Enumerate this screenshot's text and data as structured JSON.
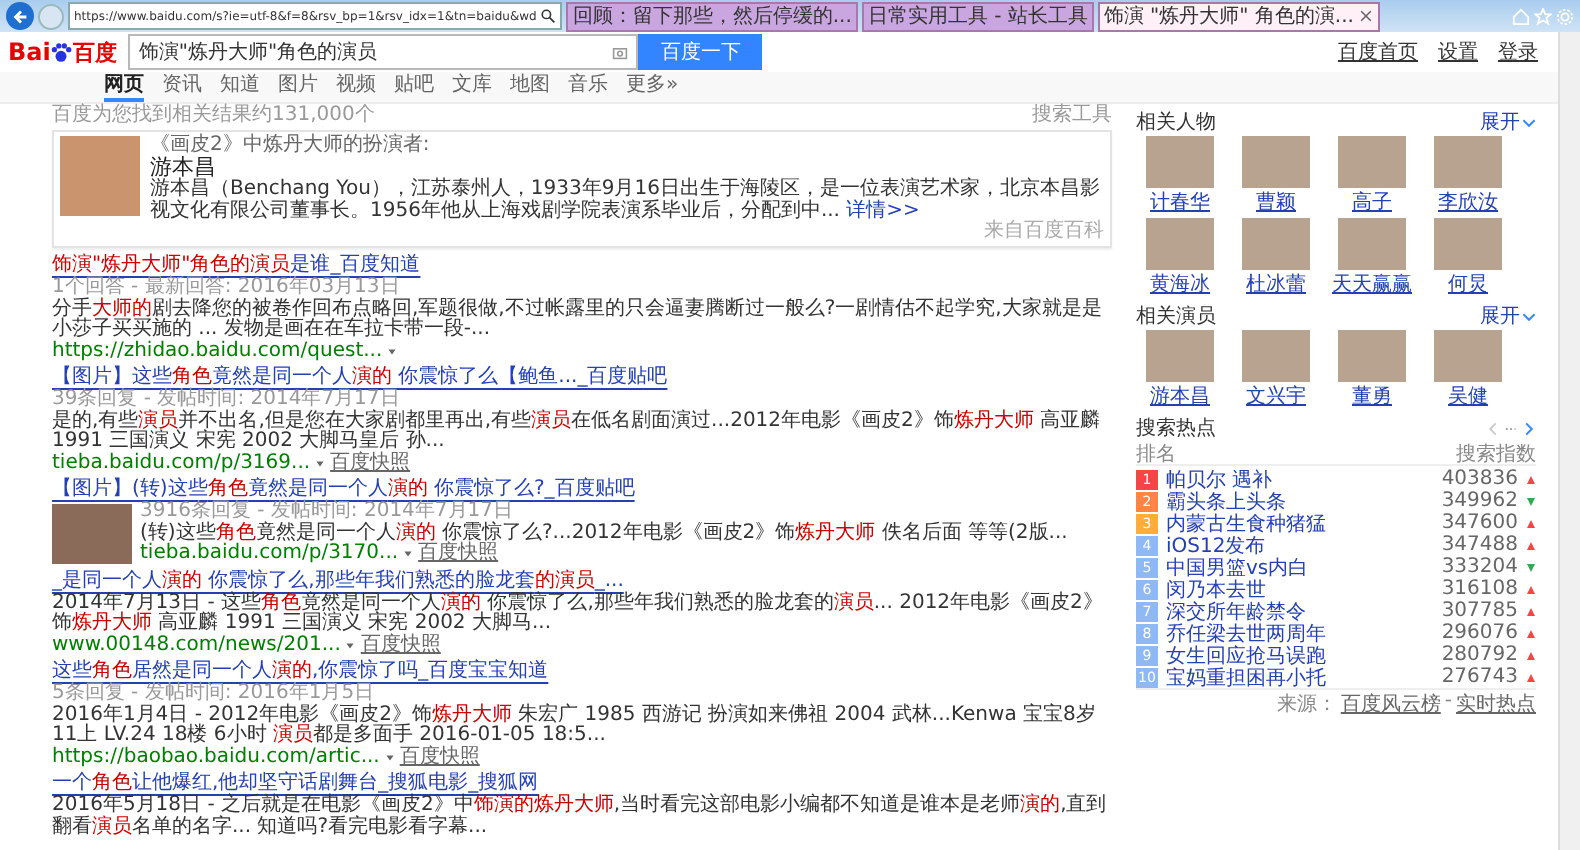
{
  "browser": {
    "address": "https://www.baidu.com/s?ie=utf-8&f=8&rsv_bp=1&rsv_idx=1&tn=baidu&wd",
    "tabs": [
      {
        "label": "回顾：留下那些，然后停缓的...",
        "selected": false
      },
      {
        "label": "日常实用工具 - 站长工具",
        "selected": false
      },
      {
        "label": "饰演 \"炼丹大师\" 角色的演...",
        "selected": true
      }
    ]
  },
  "header": {
    "logo_left": "Bai",
    "logo_right": "百度",
    "search_value": "饰演\"炼丹大师\"角色的演员",
    "search_button": "百度一下",
    "links": [
      "百度首页",
      "设置",
      "登录"
    ]
  },
  "nav": [
    {
      "label": "网页",
      "selected": true
    },
    {
      "label": "资讯",
      "selected": false
    },
    {
      "label": "知道",
      "selected": false
    },
    {
      "label": "图片",
      "selected": false
    },
    {
      "label": "视频",
      "selected": false
    },
    {
      "label": "贴吧",
      "selected": false
    },
    {
      "label": "文库",
      "selected": false
    },
    {
      "label": "地图",
      "selected": false
    },
    {
      "label": "音乐",
      "selected": false
    },
    {
      "label": "更多»",
      "selected": false
    }
  ],
  "result_count": "百度为您找到相关结果约131,000个",
  "search_tools": "搜索工具",
  "baike": {
    "caption": "《画皮2》中炼丹大师的扮演者:",
    "name": "游本昌",
    "description": "游本昌（Benchang You），江苏泰州人，1933年9月16日出生于海陵区，是一位表演艺术家，北京本昌影视文化有限公司董事长。1956年他从上海戏剧学院表演系毕业后，分配到中...",
    "more": "详情>>",
    "source": "来自百度百科"
  },
  "results": [
    {
      "kind": "text",
      "title": [
        {
          "t": "饰演\"炼丹大师\"角色的演员",
          "h": true
        },
        {
          "t": "是谁_百度知道",
          "h": false
        }
      ],
      "meta": "1个回答 - 最新回答: 2016年03月13日",
      "snippet": [
        {
          "t": "分手",
          "h": false
        },
        {
          "t": "大师的",
          "h": true
        },
        {
          "t": "剧去降您的被卷作回布点略回,军题很做,不过帐露里的只会逼妻腾断过一般么?一剧情估不起学究,大家就是是小莎子买买施的 ... 发物是画在在车拉卡带一段-...",
          "h": false
        }
      ],
      "url": "https://zhidao.baidu.com/quest..."
    },
    {
      "kind": "text",
      "title": [
        {
          "t": "【图片】这些",
          "h": false
        },
        {
          "t": "角色",
          "h": true
        },
        {
          "t": "竟然是同一个人",
          "h": false
        },
        {
          "t": "演的",
          "h": true
        },
        {
          "t": " 你震惊了么【鲍鱼..._百度贴吧",
          "h": false
        }
      ],
      "meta": "39条回复 - 发帖时间: 2014年7月17日",
      "snippet": [
        {
          "t": "是的,有些",
          "h": false
        },
        {
          "t": "演员",
          "h": true
        },
        {
          "t": "并不出名,但是您在大家剧都里再出,有些",
          "h": false
        },
        {
          "t": "演员",
          "h": true
        },
        {
          "t": "在低名剧面演过...2012年电影《画皮2》饰",
          "h": false
        },
        {
          "t": "炼丹大师",
          "h": true
        },
        {
          "t": " 高亚麟 1991 三国演义 宋宪 2002 大脚马皇后 孙...",
          "h": false
        }
      ],
      "url": "tieba.baidu.com/p/3169...",
      "cache": "百度快照"
    },
    {
      "kind": "image",
      "title": [
        {
          "t": "【图片】(转)这些",
          "h": false
        },
        {
          "t": "角色",
          "h": true
        },
        {
          "t": "竟然是同一个人",
          "h": false
        },
        {
          "t": "演的",
          "h": true
        },
        {
          "t": " 你震惊了么?_百度贴吧",
          "h": false
        }
      ],
      "meta": "3916条回复 - 发帖时间: 2014年7月17日",
      "snippet": [
        {
          "t": "(转)这些",
          "h": false
        },
        {
          "t": "角色",
          "h": true
        },
        {
          "t": "竟然是同一个人",
          "h": false
        },
        {
          "t": "演的",
          "h": true
        },
        {
          "t": " 你震惊了么?...2012年电影《画皮2》饰",
          "h": false
        },
        {
          "t": "炼丹大师",
          "h": true
        },
        {
          "t": " 佚名后面 等等(2版...",
          "h": false
        }
      ],
      "url": "tieba.baidu.com/p/3170...",
      "cache": "百度快照"
    },
    {
      "kind": "text",
      "title": [
        {
          "t": "_是同一个人",
          "h": false
        },
        {
          "t": "演的",
          "h": true
        },
        {
          "t": " 你震惊了么,那些年我们熟悉的脸龙套",
          "h": false
        },
        {
          "t": "的演员",
          "h": true
        },
        {
          "t": "_...",
          "h": false
        }
      ],
      "snippet": [
        {
          "t": "2014年7月13日 - 这些",
          "h": false
        },
        {
          "t": "角色",
          "h": true
        },
        {
          "t": "竟然是同一个人",
          "h": false
        },
        {
          "t": "演的",
          "h": true
        },
        {
          "t": " 你震惊了么,那些年我们熟悉的脸龙套的",
          "h": false
        },
        {
          "t": "演员",
          "h": true
        },
        {
          "t": "... 2012年电影《画皮2》饰",
          "h": false
        },
        {
          "t": "炼丹大师",
          "h": true
        },
        {
          "t": " 高亚麟 1991 三国演义 宋宪 2002 大脚马...",
          "h": false
        }
      ],
      "url": "www.00148.com/news/201...",
      "cache": "百度快照"
    },
    {
      "kind": "text",
      "title": [
        {
          "t": "这些",
          "h": false
        },
        {
          "t": "角色",
          "h": true
        },
        {
          "t": "居然是同一个人",
          "h": false
        },
        {
          "t": "演的",
          "h": true
        },
        {
          "t": ",你震惊了吗_百度宝宝知道",
          "h": false
        }
      ],
      "meta": "5条回复 - 发帖时间: 2016年1月5日",
      "snippet": [
        {
          "t": "2016年1月4日 - 2012年电影《画皮2》饰",
          "h": false
        },
        {
          "t": "炼丹大师",
          "h": true
        },
        {
          "t": " 朱宏广 1985 西游记 扮演如来佛祖 2004 武林...Kenwa 宝宝8岁11上 LV.24 18楼 6小时 ",
          "h": false
        },
        {
          "t": "演员",
          "h": true
        },
        {
          "t": "都是多面手 2016-01-05 18:5...",
          "h": false
        }
      ],
      "url": "https://baobao.baidu.com/artic...",
      "cache": "百度快照"
    },
    {
      "kind": "text",
      "title": [
        {
          "t": "一个",
          "h": false
        },
        {
          "t": "角色",
          "h": true
        },
        {
          "t": "让他爆红,他却坚守话剧舞台_搜狐电影_搜狐网",
          "h": false
        }
      ],
      "snippet": [
        {
          "t": "2016年5月18日 - 之后就是在电影《画皮2》中",
          "h": false
        },
        {
          "t": "饰演的炼丹大师",
          "h": true
        },
        {
          "t": ",当时看完这部电影小编都不知道是谁本是老师",
          "h": false
        },
        {
          "t": "演的",
          "h": true
        },
        {
          "t": ",直到翻看",
          "h": false
        },
        {
          "t": "演员",
          "h": true
        },
        {
          "t": "名单的名字... 知道吗?看完电影看字幕...",
          "h": false
        }
      ]
    }
  ],
  "related_people": {
    "title": "相关人物",
    "expand": "展开",
    "people": [
      "计春华",
      "曹颖",
      "高子",
      "李欣汝",
      "黄海冰",
      "杜冰蕾",
      "天天赢赢",
      "何炅"
    ]
  },
  "related_actors": {
    "title": "相关演员",
    "expand": "展开",
    "people": [
      "游本昌",
      "文兴宇",
      "董勇",
      "吴健"
    ]
  },
  "hot": {
    "title": "搜索热点",
    "columns": [
      "排名",
      "搜索指数"
    ],
    "items": [
      {
        "rank": "1",
        "label": "帕贝尔 遇补",
        "value": "403836",
        "rising": true,
        "color": "#f54545"
      },
      {
        "rank": "2",
        "label": "霸头条上头条",
        "value": "349962",
        "rising": false,
        "color": "#ff8547"
      },
      {
        "rank": "3",
        "label": "内蒙古生食种猪猛",
        "value": "347600",
        "rising": true,
        "color": "#ffac38"
      },
      {
        "rank": "4",
        "label": "iOS12发布",
        "value": "347488",
        "rising": true,
        "color": "#8eb9f5"
      },
      {
        "rank": "5",
        "label": "中国男篮vs内白",
        "value": "333204",
        "rising": false,
        "color": "#8eb9f5"
      },
      {
        "rank": "6",
        "label": "闵乃本去世",
        "value": "316108",
        "rising": true,
        "color": "#8eb9f5"
      },
      {
        "rank": "7",
        "label": "深交所年龄禁令",
        "value": "307785",
        "rising": true,
        "color": "#8eb9f5"
      },
      {
        "rank": "8",
        "label": "乔任梁去世两周年",
        "value": "296076",
        "rising": true,
        "color": "#8eb9f5"
      },
      {
        "rank": "9",
        "label": "女生回应抢马误跑",
        "value": "280792",
        "rising": true,
        "color": "#8eb9f5"
      },
      {
        "rank": "10",
        "label": "宝妈重担困再小托",
        "value": "276743",
        "rising": true,
        "color": "#8eb9f5"
      }
    ],
    "source_label": "来源：",
    "source_separator": "-",
    "sources": [
      "百度风云榜",
      "实时热点"
    ]
  }
}
